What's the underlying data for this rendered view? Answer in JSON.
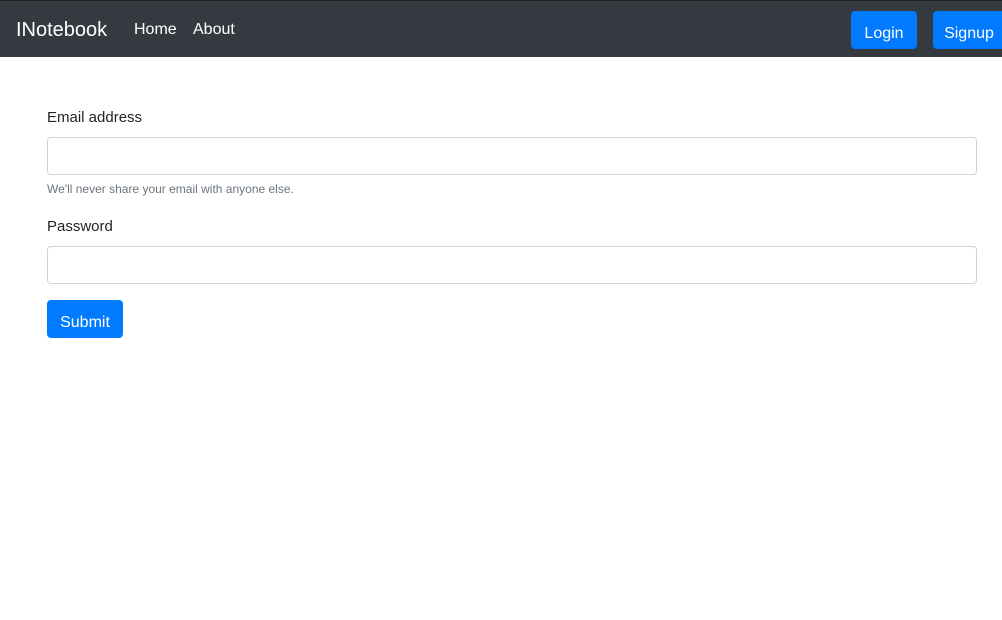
{
  "navbar": {
    "brand": "INotebook",
    "links": [
      {
        "label": "Home"
      },
      {
        "label": "About"
      }
    ],
    "login_label": "Login",
    "signup_label": "Signup"
  },
  "form": {
    "email": {
      "label": "Email address",
      "value": "",
      "help": "We'll never share your email with anyone else."
    },
    "password": {
      "label": "Password",
      "value": ""
    },
    "submit_label": "Submit"
  },
  "colors": {
    "navbar_bg": "#343a40",
    "primary": "#007bff",
    "help_text": "#6c757d",
    "input_border": "#ced4da"
  }
}
